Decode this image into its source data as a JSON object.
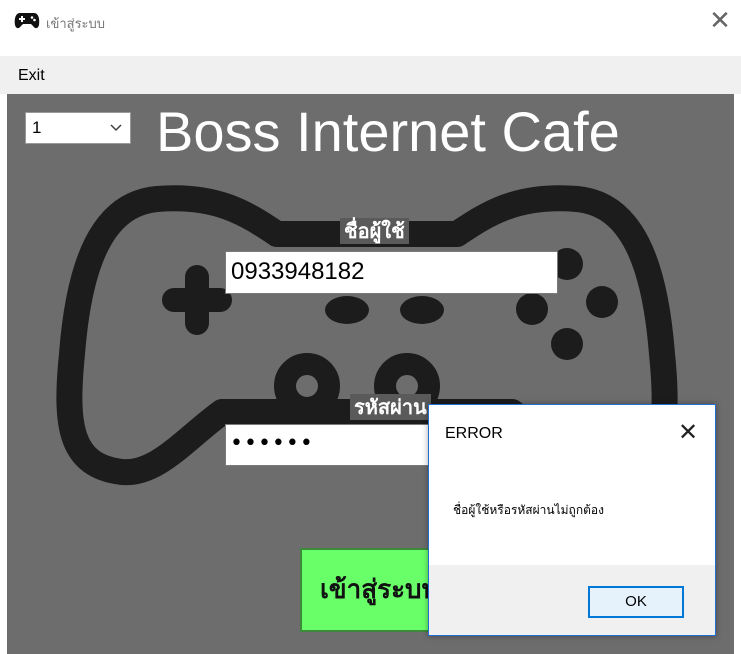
{
  "window": {
    "title": "เข้าสู่ระบบ",
    "app_icon": "gamepad-icon",
    "close_icon": "close-icon",
    "close_glyph": "✕"
  },
  "menu": {
    "items": [
      {
        "label": "Exit"
      }
    ]
  },
  "station_select": {
    "value": "1",
    "icon": "chevron-down-icon"
  },
  "header": {
    "title": "Boss Internet Cafe"
  },
  "login_form": {
    "username_label": "ชื่อผู้ใช้",
    "username_value": "0933948182",
    "password_label": "รหัสผ่าน",
    "password_value": "••••••",
    "submit_label": "เข้าสู่ระบบ"
  },
  "background": {
    "icon": "gamepad-icon"
  },
  "error_dialog": {
    "title": "ERROR",
    "close_glyph": "✕",
    "message": "ชื่อผู้ใช้หรือรหัสผ่านไม่ถูกต้อง",
    "ok_label": "OK"
  },
  "colors": {
    "background": "#6d6d6d",
    "login_button": "#69ff69",
    "dialog_accent": "#0078d7"
  }
}
